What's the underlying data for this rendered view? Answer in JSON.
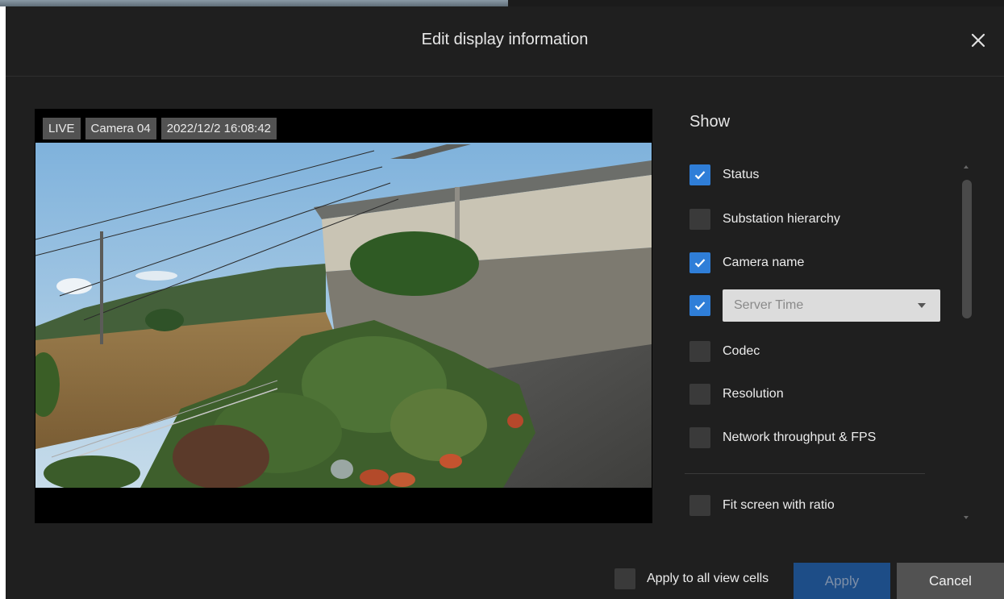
{
  "dialog": {
    "title": "Edit display information"
  },
  "preview": {
    "status_tag": "LIVE",
    "camera_tag": "Camera 04",
    "time_tag": "2022/12/2 16:08:42"
  },
  "show_panel": {
    "title": "Show",
    "options": [
      {
        "label": "Status",
        "checked": true
      },
      {
        "label": "Substation hierarchy",
        "checked": false
      },
      {
        "label": "Camera name",
        "checked": true
      },
      {
        "label": "",
        "checked": true
      },
      {
        "label": "Codec",
        "checked": false
      },
      {
        "label": "Resolution",
        "checked": false
      },
      {
        "label": "Network throughput & FPS",
        "checked": false
      },
      {
        "label": "Fit screen with ratio",
        "checked": false
      }
    ],
    "time_source_select": {
      "value": "Server Time"
    }
  },
  "footer": {
    "apply_all_label": "Apply to all view cells",
    "apply_all_checked": false,
    "apply_label": "Apply",
    "cancel_label": "Cancel"
  },
  "colors": {
    "accent": "#2f7ed8",
    "dialog_bg": "#1f1f1f",
    "apply_bg": "#1d4d87"
  },
  "icons": [
    "close-icon",
    "checkmark-icon",
    "chevron-down-icon"
  ]
}
